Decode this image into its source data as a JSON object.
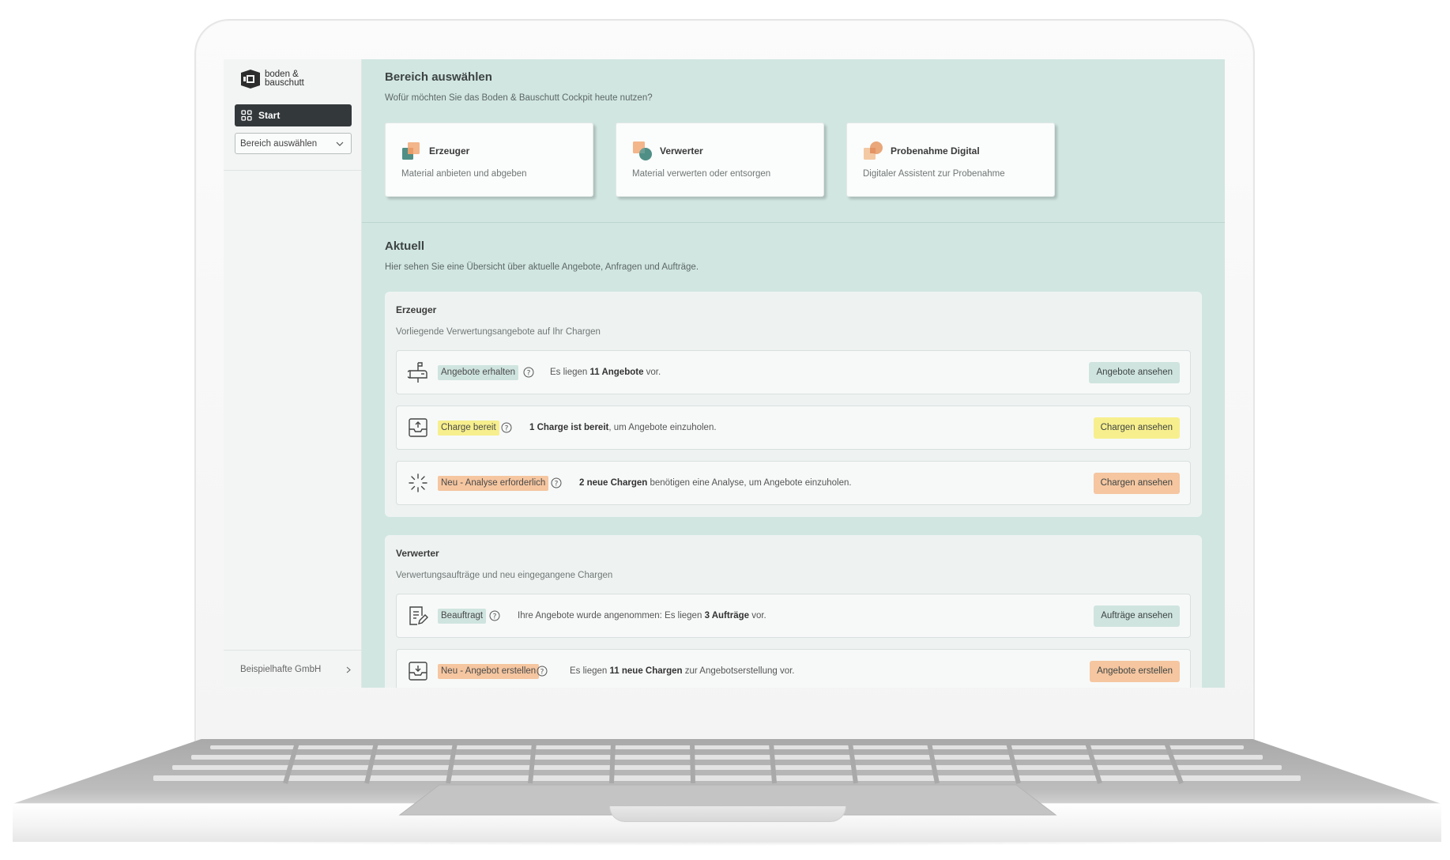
{
  "brand": {
    "logo_line1": "boden &",
    "logo_line2": "bauschutt"
  },
  "sidebar": {
    "start_label": "Start",
    "select_value": "Bereich auswählen",
    "company": "Beispielhafte GmbH"
  },
  "section_select": {
    "title": "Bereich auswählen",
    "subtitle": "Wofür möchten Sie das Boden & Bauschutt Cockpit heute nutzen?",
    "cards": [
      {
        "title": "Erzeuger",
        "desc": "Material anbieten und abgeben",
        "icon": "producer-icon"
      },
      {
        "title": "Verwerter",
        "desc": "Material  verwerten oder entsorgen",
        "icon": "recycler-icon"
      },
      {
        "title": "Probenahme Digital",
        "desc": "Digitaler Assistent zur Probenahme",
        "icon": "sampling-icon"
      }
    ]
  },
  "current": {
    "title": "Aktuell",
    "subtitle": "Hier sehen Sie eine Übersicht über aktuelle Angebote, Anfragen und Aufträge.",
    "producer": {
      "title": "Erzeuger",
      "subtitle": "Vorliegende Verwertungsangebote auf Ihr Chargen",
      "rows": [
        {
          "icon": "mailbox-icon",
          "status": "Angebote erhalten",
          "pre": "Es liegen ",
          "bold": "11 Angebote",
          "post": " vor.",
          "action": "Angebote ansehen"
        },
        {
          "icon": "upload-tray-icon",
          "status": "Charge bereit",
          "pre": "",
          "bold": "1 Charge ist bereit",
          "post": ", um Angebote einzuholen.",
          "action": "Chargen ansehen"
        },
        {
          "icon": "loading-icon",
          "status": "Neu - Analyse erforderlich",
          "pre": "",
          "bold": "2 neue Chargen",
          "post": " benötigen eine Analyse, um Angebote einzuholen.",
          "action": "Chargen ansehen"
        }
      ]
    },
    "recycler": {
      "title": "Verwerter",
      "subtitle": "Verwertungsaufträge und neu eingegangene Chargen",
      "rows": [
        {
          "icon": "contract-edit-icon",
          "status": "Beauftragt",
          "pre": "Ihre Angebote wurde angenommen: Es liegen ",
          "bold": "3 Aufträge",
          "post": " vor.",
          "action": "Aufträge ansehen"
        },
        {
          "icon": "download-tray-icon",
          "status": "Neu - Angebot erstellen",
          "pre": "Es liegen ",
          "bold": "11 neue Chargen",
          "post": " zur Angebotserstellung  vor.",
          "action": "Angebote erstellen"
        }
      ]
    }
  },
  "colors": {
    "screen_bg": "#d1e6e1",
    "sidebar_bg": "#f3f5f4",
    "start_bg": "#33383a",
    "status_green": "#cfe4df",
    "status_yellow": "#f7ef8d",
    "status_orange": "#f5c6a0",
    "accent_orange": "#f0a470",
    "accent_teal": "#3f8a80"
  }
}
